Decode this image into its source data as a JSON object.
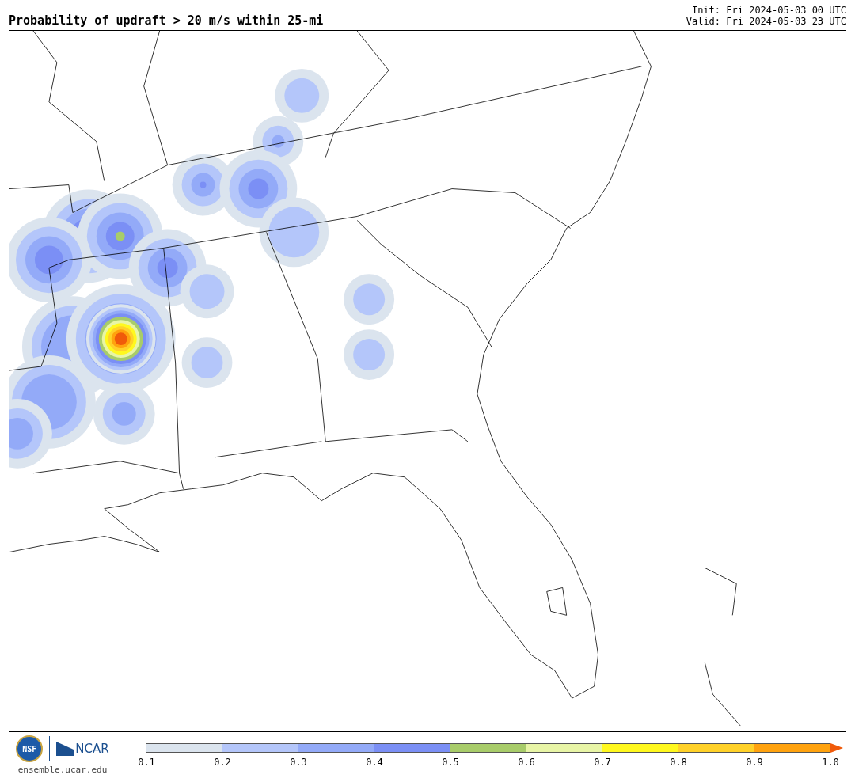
{
  "title": "Probability of updraft > 20 m/s within 25-mi",
  "init": "Init: Fri 2024-05-03 00 UTC",
  "valid": "Valid: Fri 2024-05-03 23 UTC",
  "logos": {
    "nsf": "NSF",
    "ncar": "NCAR",
    "site": "ensemble.ucar.edu"
  },
  "colorbar": {
    "bins": [
      {
        "color": "#dbe4ee"
      },
      {
        "color": "#b4c6fa"
      },
      {
        "color": "#93aaf8"
      },
      {
        "color": "#7b8ff5"
      },
      {
        "color": "#a8cc6a"
      },
      {
        "color": "#e8f5a6"
      },
      {
        "color": "#fff81e"
      },
      {
        "color": "#ffd129"
      },
      {
        "color": "#ffa20e"
      },
      {
        "kind": "arrow",
        "color": "#f05a0a"
      }
    ],
    "ticks": [
      "0.1",
      "0.2",
      "0.3",
      "0.4",
      "0.5",
      "0.6",
      "0.7",
      "0.8",
      "0.9",
      "1.0"
    ]
  }
}
